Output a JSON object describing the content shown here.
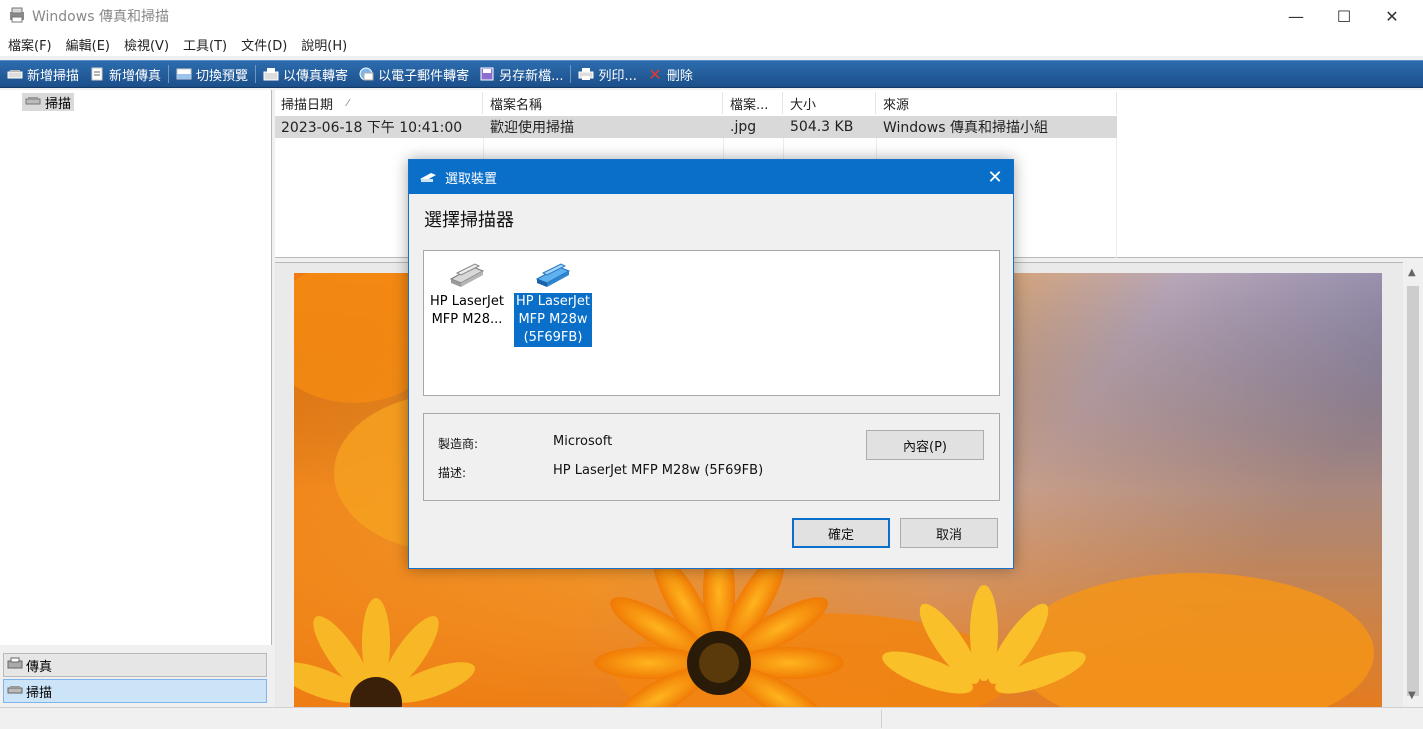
{
  "window": {
    "title": "Windows 傳真和掃描",
    "minimize": "—",
    "maximize": "☐",
    "close": "✕"
  },
  "menu": [
    "檔案(F)",
    "編輯(E)",
    "檢視(V)",
    "工具(T)",
    "文件(D)",
    "說明(H)"
  ],
  "toolbar": {
    "new_scan": "新增掃描",
    "new_fax": "新增傳真",
    "toggle_preview": "切換預覽",
    "forward_fax": "以傳真轉寄",
    "forward_email": "以電子郵件轉寄",
    "save_as": "另存新檔...",
    "print": "列印...",
    "delete": "刪除"
  },
  "tree": {
    "scan_node": "掃描"
  },
  "left_bottom": {
    "fax": "傳真",
    "scan": "掃描"
  },
  "list": {
    "columns": [
      "掃描日期",
      "檔案名稱",
      "檔案...",
      "大小",
      "來源"
    ],
    "sort_indicator": "⁄",
    "rows": [
      {
        "date": "2023-06-18 下午 10:41:00",
        "name": "歡迎使用掃描",
        "type": ".jpg",
        "size": "504.3 KB",
        "source": "Windows 傳真和掃描小組"
      }
    ]
  },
  "dialog": {
    "title": "選取裝置",
    "heading": "選擇掃描器",
    "devices": [
      {
        "label_line1": "HP LaserJet",
        "label_line2": "MFP M28...",
        "label_line3": "",
        "selected": false
      },
      {
        "label_line1": "HP LaserJet",
        "label_line2": "MFP M28w",
        "label_line3": "(5F69FB)",
        "selected": true
      }
    ],
    "manufacturer_label": "製造商:",
    "manufacturer_value": "Microsoft",
    "description_label": "描述:",
    "description_value": "HP LaserJet MFP M28w (5F69FB)",
    "properties_button": "內容(P)",
    "ok_button": "確定",
    "cancel_button": "取消"
  },
  "colors": {
    "toolbar": "#1f5898",
    "selection": "#0a6fc8",
    "dialog_title": "#0a6fc8"
  }
}
